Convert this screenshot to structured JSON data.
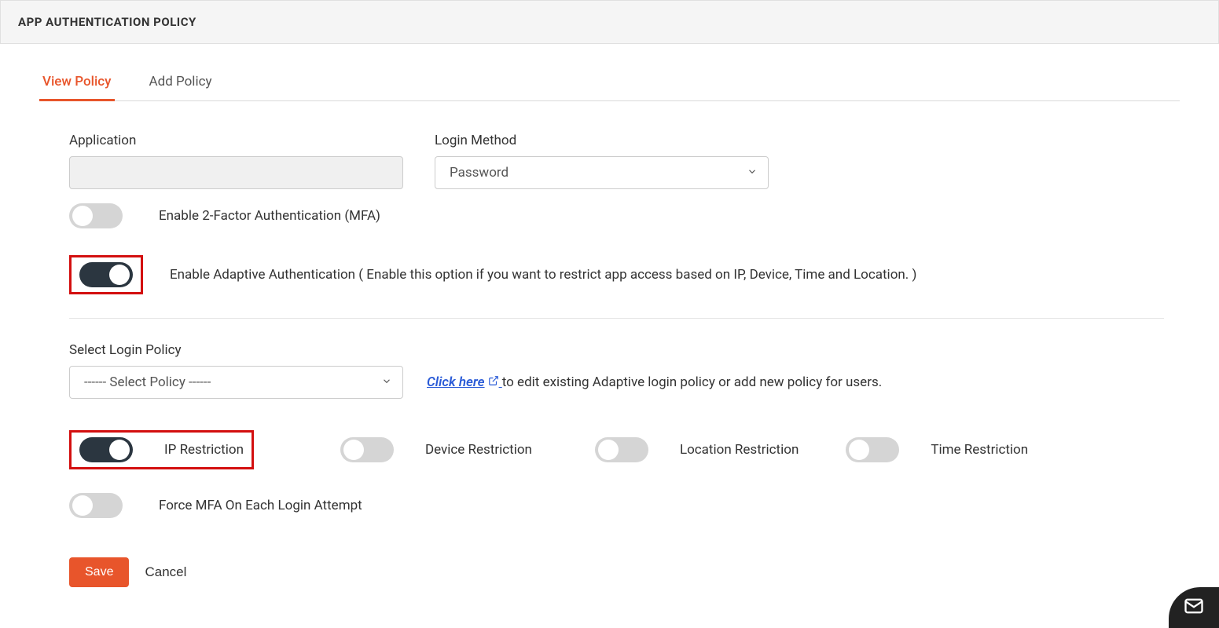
{
  "header": {
    "title": "APP AUTHENTICATION POLICY"
  },
  "tabs": {
    "view": "View Policy",
    "add": "Add Policy"
  },
  "fields": {
    "application_label": "Application",
    "application_value": "",
    "login_method_label": "Login Method",
    "login_method_value": "Password",
    "select_login_policy_label": "Select Login Policy",
    "select_login_policy_value": "------ Select Policy ------"
  },
  "toggles": {
    "mfa_label": "Enable 2-Factor Authentication (MFA)",
    "adaptive_label": "Enable Adaptive Authentication ( Enable this option if you want to restrict app access based on IP, Device, Time and Location. )",
    "ip_label": "IP Restriction",
    "device_label": "Device Restriction",
    "location_label": "Location Restriction",
    "time_label": "Time Restriction",
    "force_mfa_label": "Force MFA On Each Login Attempt"
  },
  "help": {
    "click_here": "Click here",
    "edit_policy_suffix": " to edit existing Adaptive login policy or add new policy for users."
  },
  "buttons": {
    "save": "Save",
    "cancel": "Cancel"
  }
}
